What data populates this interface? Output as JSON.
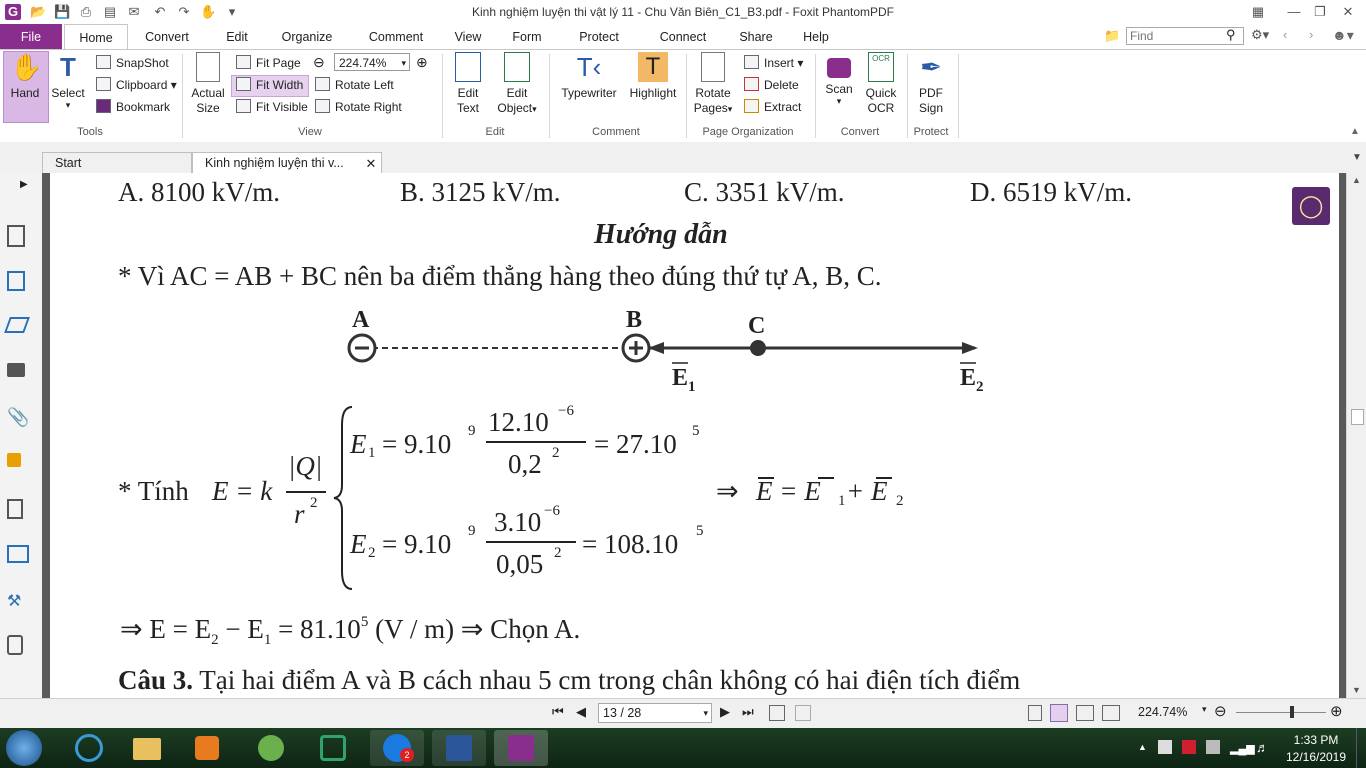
{
  "window": {
    "title": "Kinh nghiệm luyện thi vật lý 11 - Chu Văn Biên_C1_B3.pdf - Foxit PhantomPDF"
  },
  "menu_tabs": [
    "File",
    "Home",
    "Convert",
    "Edit",
    "Organize",
    "Comment",
    "View",
    "Form",
    "Protect",
    "Connect",
    "Share",
    "Help"
  ],
  "search": {
    "placeholder": "Find"
  },
  "ribbon": {
    "tools": {
      "hand": "Hand",
      "select": "Select",
      "snapshot": "SnapShot",
      "clipboard": "Clipboard",
      "bookmark": "Bookmark",
      "label": "Tools"
    },
    "view": {
      "actual_size_1": "Actual",
      "actual_size_2": "Size",
      "fit_page": "Fit Page",
      "fit_width": "Fit Width",
      "fit_visible": "Fit Visible",
      "zoom": "224.74%",
      "rotate_left": "Rotate Left",
      "rotate_right": "Rotate Right",
      "label": "View"
    },
    "edit": {
      "edit_text_1": "Edit",
      "edit_text_2": "Text",
      "edit_object_1": "Edit",
      "edit_object_2": "Object",
      "label": "Edit"
    },
    "comment": {
      "typewriter": "Typewriter",
      "highlight": "Highlight",
      "label": "Comment"
    },
    "page_org": {
      "rotate_pages_1": "Rotate",
      "rotate_pages_2": "Pages",
      "insert": "Insert",
      "delete": "Delete",
      "extract": "Extract",
      "label": "Page Organization"
    },
    "convert": {
      "scan": "Scan",
      "quick_ocr_1": "Quick",
      "quick_ocr_2": "OCR",
      "label": "Convert"
    },
    "protect": {
      "pdf_sign_1": "PDF",
      "pdf_sign_2": "Sign",
      "label": "Protect"
    }
  },
  "doc_tabs": {
    "start": "Start",
    "current": "Kinh nghiệm luyện thi v..."
  },
  "document": {
    "options": [
      "A. 8100 kV/m.",
      "B. 3125 kV/m.",
      "C. 3351 kV/m.",
      "D. 6519 kV/m."
    ],
    "heading": "Hướng dẫn",
    "line1": "* Vì AC = AB + BC nên ba điểm thẳng hàng theo đúng thứ tự A, B, C.",
    "diagram": {
      "A": "A",
      "B": "B",
      "C": "C",
      "E1": "E",
      "E1sub": "1",
      "E2": "E",
      "E2sub": "2"
    },
    "formula": {
      "intro": "* Tính",
      "lhs": "E = k",
      "Q": "|Q|",
      "r2": "r",
      "r2sup": "2",
      "e1_lhs": "E",
      "e1_sub": "1",
      "e1_eq": "= 9.10",
      "e1_pow": "9",
      "e1_num": "12.10",
      "e1_num_pow": "−6",
      "e1_den": "0,2",
      "e1_den_pow": "2",
      "e1_res": "= 27.10",
      "e1_res_pow": "5",
      "e2_lhs": "E",
      "e2_sub": "2",
      "e2_eq": "= 9.10",
      "e2_pow": "9",
      "e2_num": "3.10",
      "e2_num_pow": "−6",
      "e2_den": "0,05",
      "e2_den_pow": "2",
      "e2_res": "= 108.10",
      "e2_res_pow": "5",
      "implies": "⇒",
      "vec_sum": "E = E",
      "vec_sub1": "1",
      "vec_plus": " + E",
      "vec_sub2": "2"
    },
    "result": {
      "pre": "⇒ E = E",
      "s2": "2",
      "mid": " − E",
      "s1": "1",
      "eq": " = 81.10",
      "pow": "5",
      "unit": " (V / m) ⇒ Chọn A."
    },
    "question3_label": "Câu 3.",
    "question3_text": " Tại hai điểm A và B cách nhau 5 cm trong chân không có hai điện tích điểm"
  },
  "status": {
    "page": "13 / 28",
    "zoom": "224.74%"
  },
  "taskbar": {
    "time": "1:33 PM",
    "date": "12/16/2019",
    "zalo_badge": "2"
  },
  "colors": {
    "file_tab": "#8a2e8e",
    "taskbar": "#163220",
    "hand_active": "#d9b8e6"
  }
}
